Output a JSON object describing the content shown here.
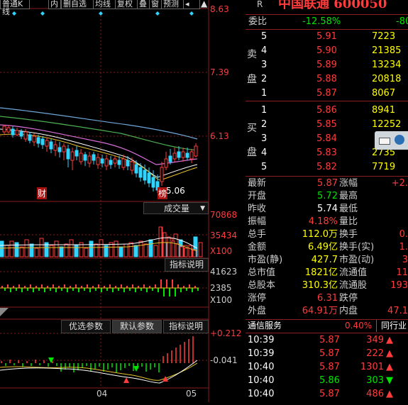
{
  "toolbar": {
    "kline_label": "普通K线",
    "items": [
      "内",
      "删自选",
      "均线",
      "复权",
      "叠",
      "窗",
      "预测",
      "◂"
    ]
  },
  "price_axis": [
    "8.63",
    "7.39",
    "6.13"
  ],
  "chart_marks": {
    "low_price": "5.06",
    "label_cai": "财",
    "label_bang": "榜"
  },
  "volume_pane": {
    "menu_label": "成交量",
    "axis": [
      "70868",
      "35434"
    ],
    "unit": "X100",
    "button": "指标说明"
  },
  "mid_pane": {
    "axis": [
      "41623",
      "2385"
    ],
    "unit": "X100"
  },
  "lower_tabs": {
    "items": [
      "优选参数",
      "默认参数",
      "指标说明"
    ],
    "active": 1
  },
  "macd_pane": {
    "axis": [
      "+0.212",
      "-0.041"
    ]
  },
  "x_axis": [
    "04",
    "05"
  ],
  "header": {
    "tag": "R",
    "title": "中国联通 600050"
  },
  "weibi": {
    "label": "委比",
    "value": "-12.58%",
    "diff": "-80"
  },
  "sell": {
    "label": [
      "卖",
      "盘"
    ],
    "rows": [
      {
        "level": "5",
        "price": "5.91",
        "vol": "7223"
      },
      {
        "level": "4",
        "price": "5.90",
        "vol": "21385"
      },
      {
        "level": "3",
        "price": "5.89",
        "vol": "13234"
      },
      {
        "level": "2",
        "price": "5.88",
        "vol": "20818"
      },
      {
        "level": "1",
        "price": "5.87",
        "vol": "8067"
      }
    ]
  },
  "buy": {
    "label": [
      "买",
      "盘"
    ],
    "rows": [
      {
        "level": "1",
        "price": "5.86",
        "vol": "8941"
      },
      {
        "level": "2",
        "price": "5.85",
        "vol": "12252"
      },
      {
        "level": "3",
        "price": "5.84",
        "vol": ""
      },
      {
        "level": "4",
        "price": "5.83",
        "vol": "2735"
      },
      {
        "level": "5",
        "price": "5.82",
        "vol": "7719"
      }
    ]
  },
  "stats": [
    {
      "l": "最新",
      "v": "5.87",
      "vc": "red",
      "r": "涨幅",
      "rv": "+2."
    },
    {
      "l": "开盘",
      "v": "5.72",
      "vc": "green",
      "r": "最高",
      "rv": ""
    },
    {
      "l": "昨收",
      "v": "5.74",
      "vc": "white",
      "r": "最低",
      "rv": ""
    },
    {
      "l": "振幅",
      "v": "4.18%",
      "vc": "red",
      "r": "量比",
      "rv": ""
    },
    {
      "l": "总手",
      "v": "112.0万",
      "vc": "yellow",
      "r": "换手",
      "rv": "0."
    },
    {
      "l": "金额",
      "v": "6.49亿",
      "vc": "yellow",
      "r": "换手(实)",
      "rv": "1."
    },
    {
      "l": "市盈(静)",
      "v": "427.7",
      "vc": "yellow",
      "r": "市盈(动)",
      "rv": "3"
    },
    {
      "l": "总市值",
      "v": "1821亿",
      "vc": "yellow",
      "r": "流通值",
      "rv": "11"
    },
    {
      "l": "总股本",
      "v": "310.3亿",
      "vc": "yellow",
      "r": "流通股",
      "rv": "193"
    },
    {
      "l": "涨停",
      "v": "6.31",
      "vc": "red",
      "r": "跌停",
      "rv": ""
    },
    {
      "l": "外盘",
      "v": "64.91万",
      "vc": "red",
      "r": "内盘",
      "rv": "47.1"
    }
  ],
  "service": {
    "label": "通信服务",
    "pct": "0.40%",
    "right": "同行业"
  },
  "ticks": [
    {
      "time": "10:39",
      "price": "5.87",
      "vol": "349",
      "dir": "up"
    },
    {
      "time": "10:39",
      "price": "5.87",
      "vol": "222",
      "dir": "up"
    },
    {
      "time": "10:40",
      "price": "5.87",
      "vol": "1301",
      "dir": "up"
    },
    {
      "time": "10:40",
      "price": "5.86",
      "vol": "303",
      "dir": "down"
    },
    {
      "time": "10:40",
      "price": "5.87",
      "vol": "486",
      "dir": "up"
    }
  ],
  "colors": {
    "up": "#ff3c3c",
    "down": "#00e600",
    "volume": "#2fd4ff",
    "grid": "#8a1d1d"
  }
}
